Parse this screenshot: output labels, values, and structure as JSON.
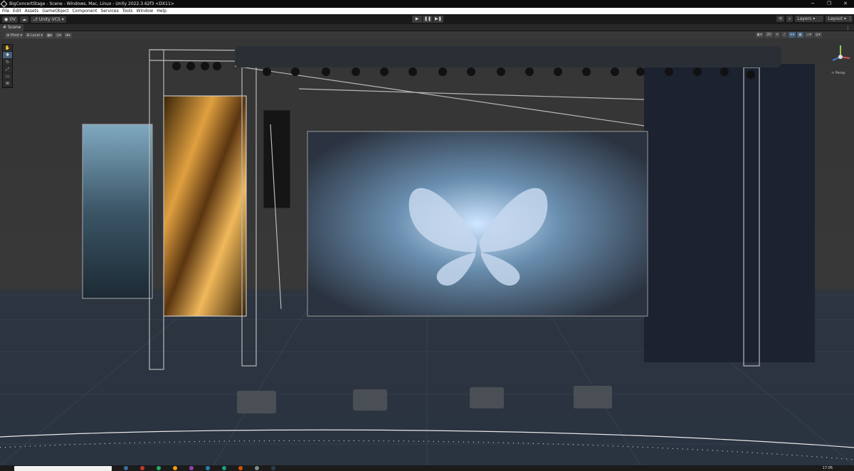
{
  "window": {
    "title": "BigConcertStage - Scene - Windows, Mac, Linux - Unity 2022.3.62f3 <DX11>",
    "minimize": "─",
    "maximize": "❐",
    "close": "✕"
  },
  "menu": [
    "File",
    "Edit",
    "Assets",
    "GameObject",
    "Component",
    "Services",
    "Tools",
    "Window",
    "Help"
  ],
  "toolbar": {
    "account": "OV",
    "vcs": "Unity VCS",
    "play": "▶",
    "pause": "❚❚",
    "step": "▶❚",
    "layers": "Layers",
    "layout": "Layout",
    "more": "⋮"
  },
  "tabs": {
    "scene": "Scene",
    "more": "⋮"
  },
  "scene_toolbar": {
    "pivot": "Pivot",
    "local": "Local",
    "mode_2d": "2D"
  },
  "gizmo": {
    "label": "< Persp"
  },
  "taskbar": {
    "clock": "17:06"
  },
  "colors": {
    "accent": "#46607a",
    "menubar": "#ffffff",
    "titlebar": "#0c0c0c",
    "toolbar": "#191919",
    "scene_bg": "#383838"
  }
}
